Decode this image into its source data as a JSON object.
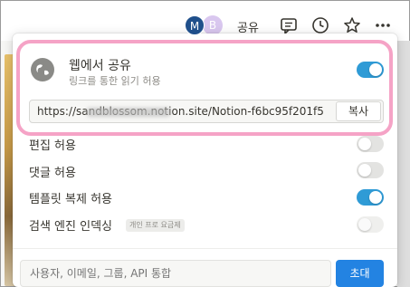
{
  "topbar": {
    "avatars": [
      "M",
      "B"
    ],
    "share_label": "공유",
    "icons": [
      "comment-icon",
      "clock-icon",
      "star-icon",
      "more-icon"
    ]
  },
  "publish": {
    "title": "웹에서 공유",
    "subtitle": "링크를 통한 읽기 허용",
    "enabled": true,
    "url": "https://sandblossom.notion.site/Notion-f6bc95f201f5",
    "copy_label": "복사"
  },
  "options": [
    {
      "label": "편집 허용",
      "enabled": false
    },
    {
      "label": "댓글 허용",
      "enabled": false
    },
    {
      "label": "템플릿 복제 허용",
      "enabled": true
    },
    {
      "label": "검색 엔진 인덱싱",
      "enabled": false,
      "badge": "개인 프로 요금제"
    }
  ],
  "invite": {
    "placeholder": "사용자, 이메일, 그룹, API 통합",
    "button_label": "초대"
  },
  "colors": {
    "accent": "#2383e2",
    "toggle_on": "#2f9bd6",
    "highlight": "#f5a3c6"
  }
}
